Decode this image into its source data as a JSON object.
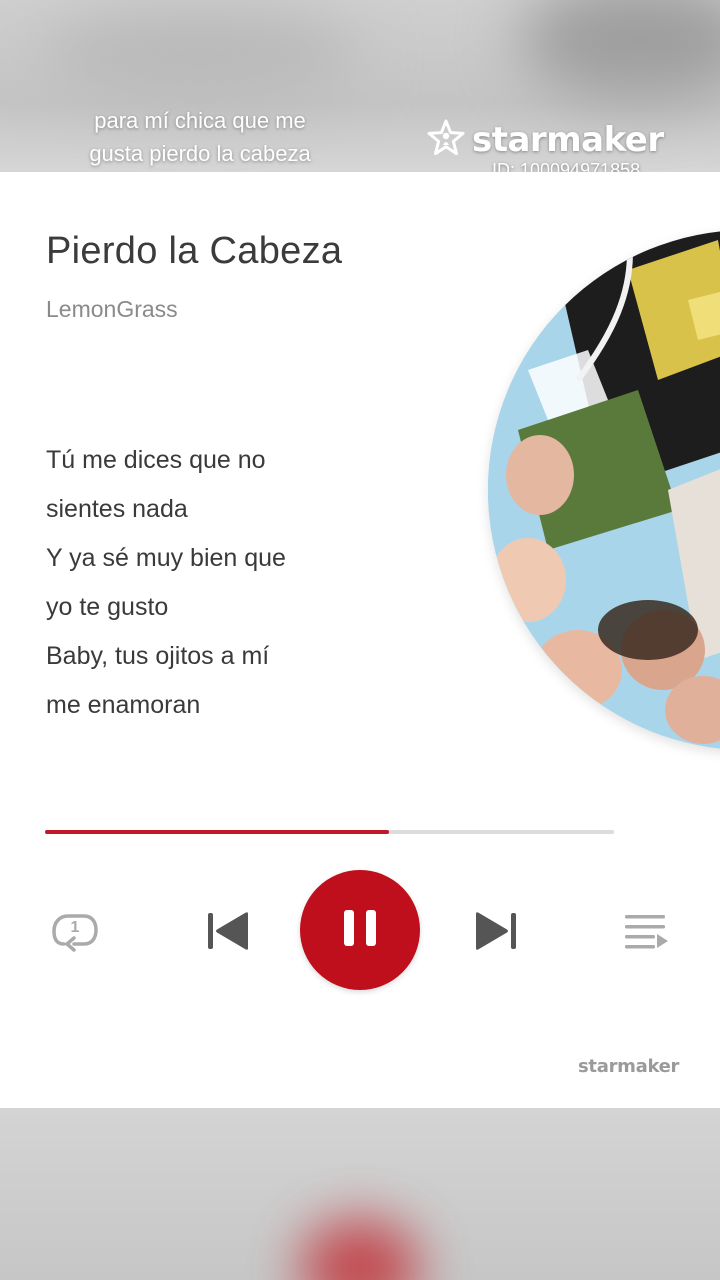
{
  "overlay": {
    "caption_line1": "para mí chica que me",
    "caption_line2": "gusta pierdo la cabeza",
    "brand": "starmaker",
    "user_id": "ID: 100094971858"
  },
  "player": {
    "song_title": "Pierdo la Cabeza",
    "artist": "LemonGrass",
    "lyrics": [
      "Tú me dices que no",
      "sientes nada",
      "Y ya sé muy bien que",
      "yo te gusto",
      "Baby, tus ojitos a mí",
      "me enamoran"
    ],
    "progress_fraction": 0.605,
    "state": "playing",
    "repeat_count": "1",
    "watermark": "starmaker"
  },
  "icons": {
    "repeat": "repeat-one-icon",
    "previous": "skip-previous-icon",
    "pause": "pause-icon",
    "next": "skip-next-icon",
    "playlist": "playlist-icon",
    "logo": "star-logo-icon"
  },
  "colors": {
    "accent": "#bf0f1c",
    "progress": "#c01a2a",
    "title_text": "#3b3b3b",
    "secondary_text": "#8a8a8a",
    "icon_gray": "#555555"
  }
}
